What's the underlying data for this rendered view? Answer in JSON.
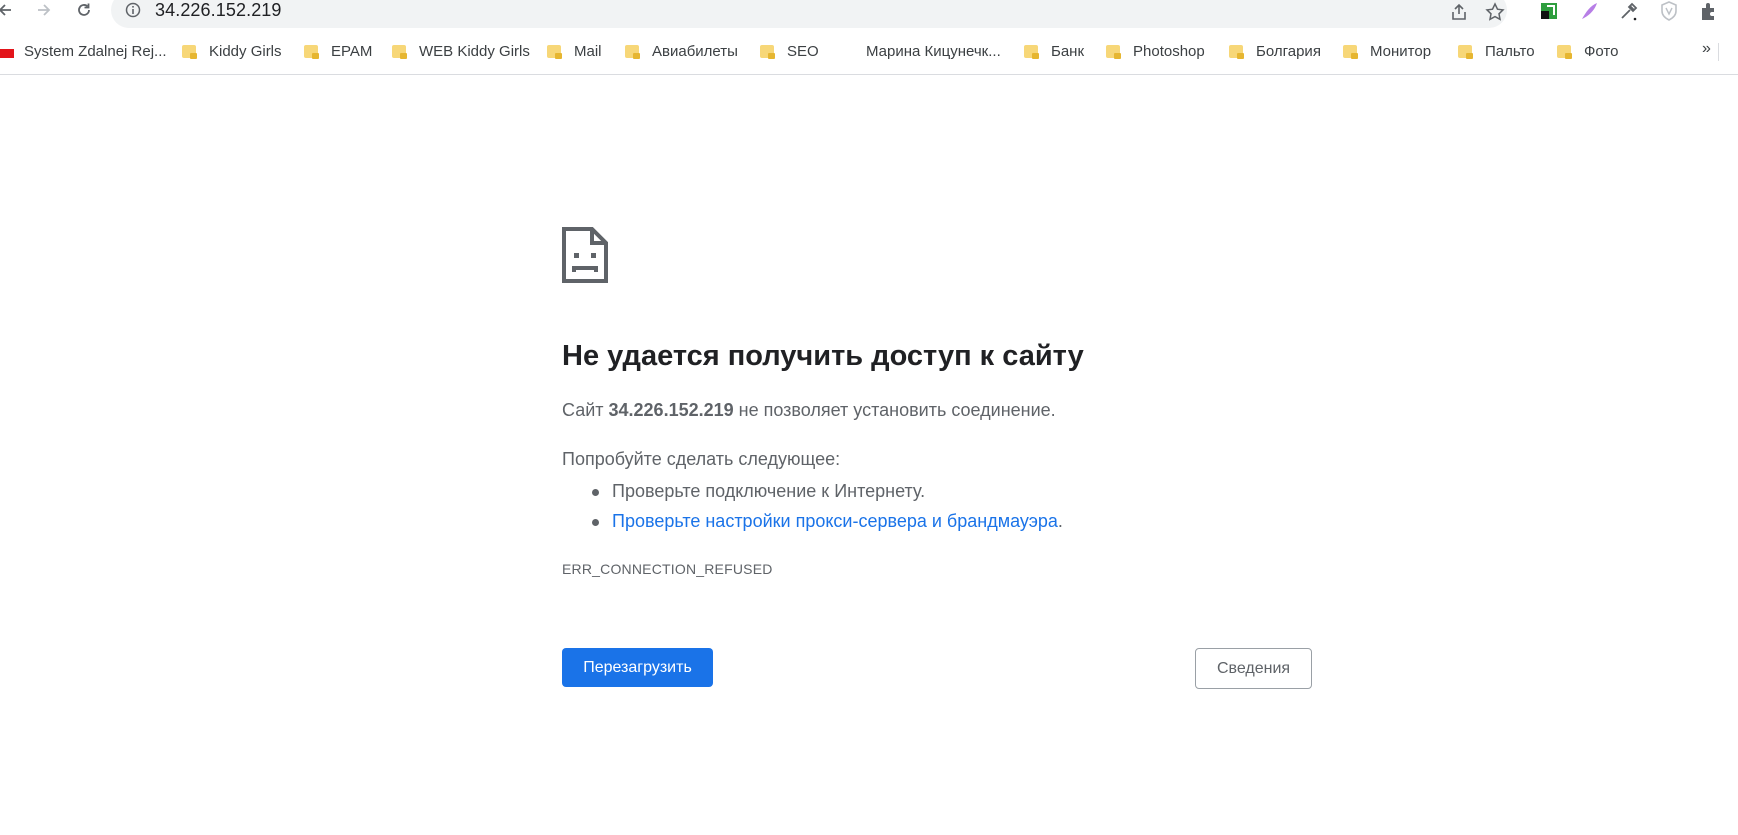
{
  "toolbar": {
    "url": "34.226.152.219"
  },
  "bookmarks": [
    {
      "label": "System Zdalnej Rej..."
    },
    {
      "label": "Kiddy Girls"
    },
    {
      "label": "EPAM"
    },
    {
      "label": "WEB Kiddy Girls"
    },
    {
      "label": "Mail"
    },
    {
      "label": "Авиабилеты"
    },
    {
      "label": "SEO"
    },
    {
      "label": "Марина Кицунечк..."
    },
    {
      "label": "Банк"
    },
    {
      "label": "Photoshop"
    },
    {
      "label": "Болгария"
    },
    {
      "label": "Монитор"
    },
    {
      "label": "Пальто"
    },
    {
      "label": "Фото"
    }
  ],
  "bookmarks_overflow": "»",
  "error": {
    "title": "Не удается получить доступ к сайту",
    "desc_prefix": "Сайт ",
    "desc_host": "34.226.152.219",
    "desc_suffix": " не позволяет установить соединение.",
    "try_label": "Попробуйте сделать следующее:",
    "suggestion_1": "Проверьте подключение к Интернету.",
    "suggestion_2_link": "Проверьте настройки прокси-сервера и брандмауэра",
    "suggestion_2_end": ".",
    "code": "ERR_CONNECTION_REFUSED",
    "reload_label": "Перезагрузить",
    "details_label": "Сведения"
  }
}
